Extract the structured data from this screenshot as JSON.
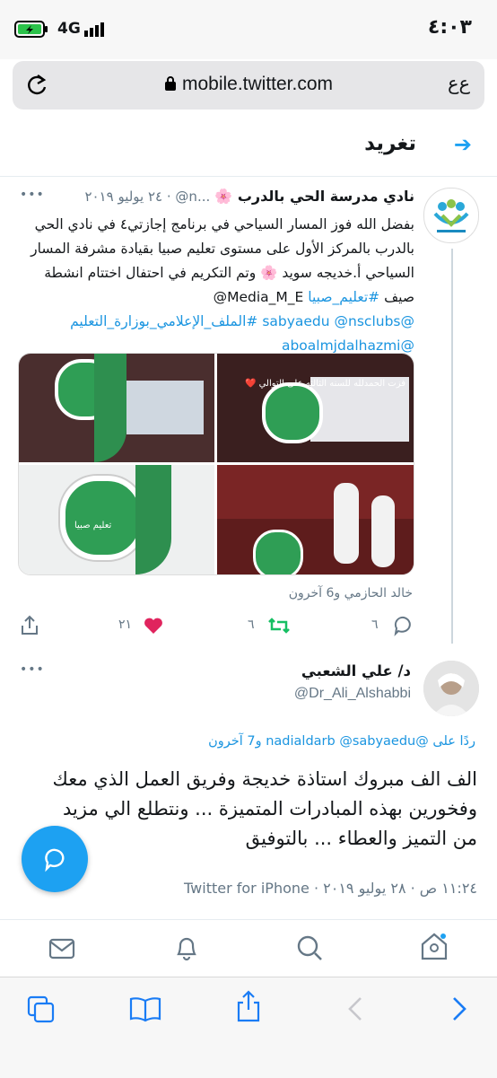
{
  "status_bar": {
    "time": "٤:٠٣",
    "network": "4G"
  },
  "url_bar": {
    "domain": "mobile.twitter.com",
    "text_size_label": "ﻉﻉ"
  },
  "header": {
    "title": "تغريد"
  },
  "tweet1": {
    "author": "نادي مدرسة الحي بالدرب 🌸",
    "handle_meta": "...n@ · ٢٤ يوليو ٢٠١٩",
    "more": "•••",
    "text_line1": "بفضل الله فوز المسار السياحي في برنامج إجازتي٤ في نادي الحي",
    "text_line2": "بالدرب بالمركز الأول على مستوى تعليم صبيا  بقيادة مشرفة المسار",
    "text_line3": "السياحي أ.خديجه سويد 🌸 وتم التكريم في احتفال اختتام انشطة",
    "text_line4_a": "صيف ",
    "text_line4_tag": "#تعليم_صبيا",
    "text_line4_b": " Media_M_E@",
    "mentions_line1": "@sabyaedu @nsclubs #الملف_الإعلامي_بوزارة_التعليم",
    "mentions_line2": "@aboalmjdalhazmi",
    "media_caption": "فزت الحمدلله للسنه الثالثه على التوالي ❤️",
    "media_badge": "تعليم صبيا",
    "tagged": "خالد الحازمي و6 آخرون",
    "replies": "٦",
    "retweets": "٦",
    "likes": "٢١"
  },
  "tweet2": {
    "author": "د/ علي الشعبي",
    "handle": "@Dr_Ali_Alshabbi",
    "more": "•••",
    "reply_to": "ردًا على @nadialdarb @sabyaedu و7 آخرون",
    "text_line1": "الف الف مبروك استاذة خديجة وفريق العمل الذي معك",
    "text_line2": "وفخورين بهذه المبادرات المتميزة ... ونتطلع الي مزيد",
    "text_line3": "من التميز والعطاء ... بالتوفيق",
    "meta": "١١:٢٤ ص · ٢٨ يوليو ٢٠١٩ · Twitter for iPhone"
  },
  "colors": {
    "accent": "#1da1f2",
    "like": "#e0245e",
    "retweet": "#17bf63"
  }
}
